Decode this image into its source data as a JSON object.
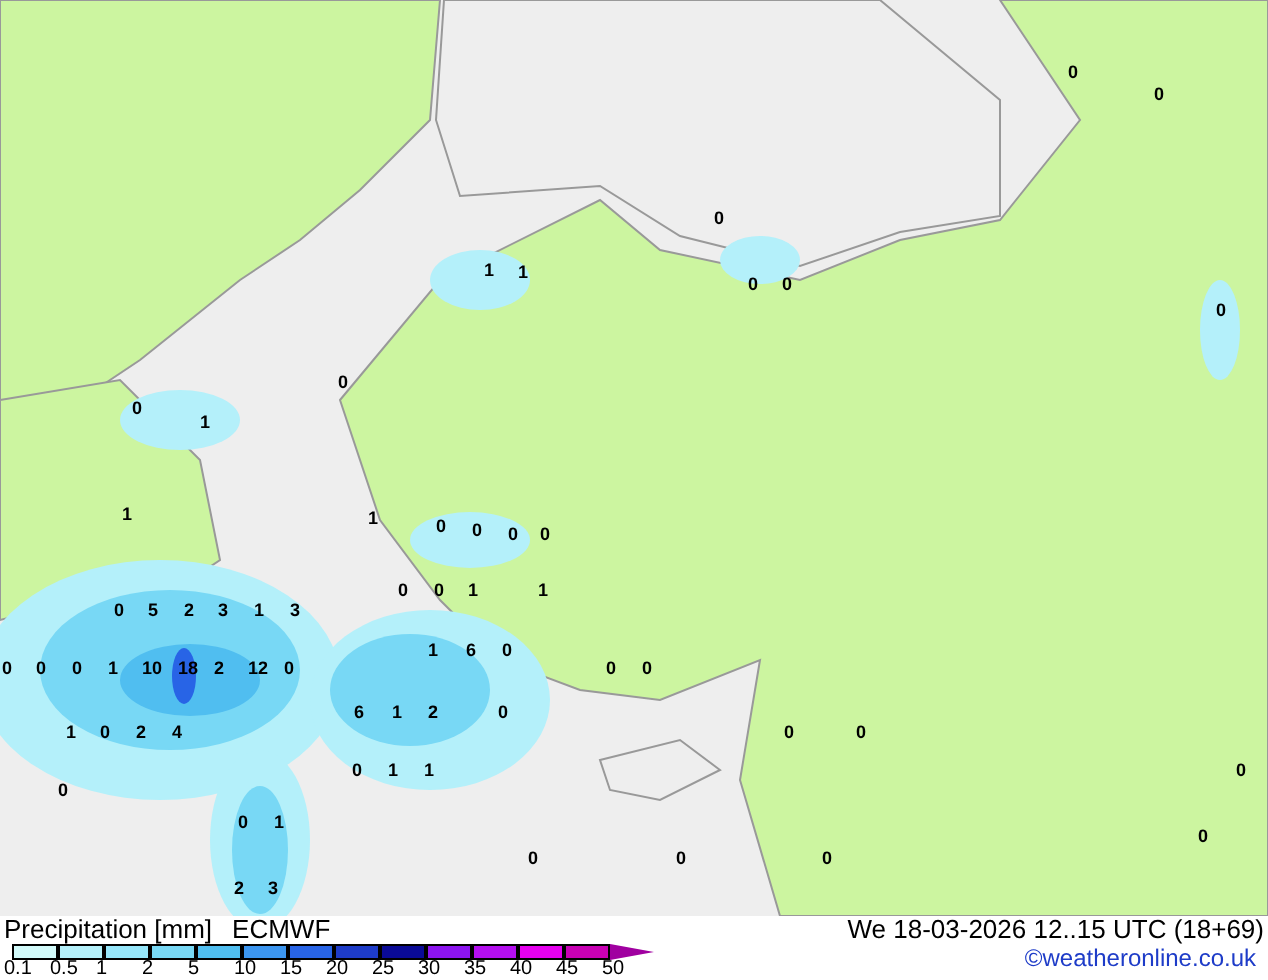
{
  "map": {
    "labels": [
      "0",
      "0",
      "0",
      "1",
      "1",
      "0",
      "0",
      "0",
      "0",
      "0",
      "1",
      "1",
      "1",
      "0",
      "0",
      "0",
      "0",
      "0",
      "0",
      "1",
      "1",
      "0",
      "5",
      "2",
      "3",
      "1",
      "3",
      "1",
      "6",
      "0",
      "0",
      "0",
      "0",
      "1",
      "10",
      "18",
      "2",
      "12",
      "0",
      "0",
      "0",
      "6",
      "1",
      "2",
      "0",
      "1",
      "0",
      "2",
      "4",
      "0",
      "0",
      "0",
      "1",
      "1",
      "0",
      "0",
      "0",
      "1",
      "0",
      "0",
      "0",
      "0",
      "2",
      "3"
    ]
  },
  "legend": {
    "title": "Precipitation [mm]",
    "model": "ECMWF",
    "datetime": "We 18-03-2026 12..15 UTC (18+69)",
    "credit": "©weatheronline.co.uk",
    "classes": [
      {
        "label": "0.1",
        "color": "#d2fafa"
      },
      {
        "label": "0.5",
        "color": "#b4f0fa"
      },
      {
        "label": "1",
        "color": "#96e6fa"
      },
      {
        "label": "2",
        "color": "#78d8f5"
      },
      {
        "label": "5",
        "color": "#50bef0"
      },
      {
        "label": "10",
        "color": "#3c96f0"
      },
      {
        "label": "15",
        "color": "#2864e6"
      },
      {
        "label": "20",
        "color": "#1e3cc8"
      },
      {
        "label": "25",
        "color": "#0a0a96"
      },
      {
        "label": "30",
        "color": "#8c14f0"
      },
      {
        "label": "35",
        "color": "#b40ff0"
      },
      {
        "label": "40",
        "color": "#e600f0"
      },
      {
        "label": "45",
        "color": "#c800b4"
      }
    ],
    "max_label": "50",
    "arrow": {
      "color": "#a000a0"
    }
  }
}
